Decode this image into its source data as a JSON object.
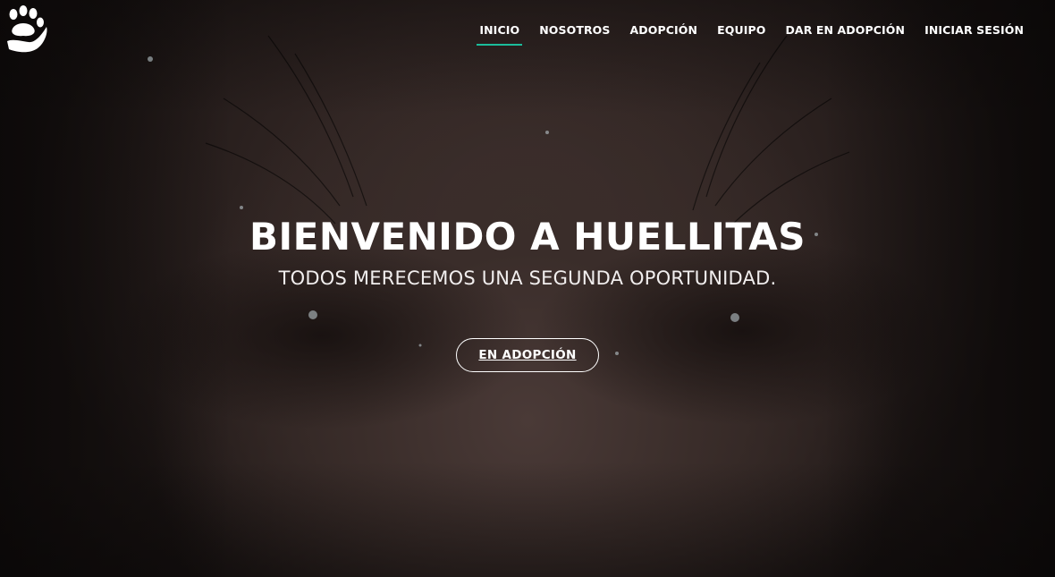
{
  "colors": {
    "accent": "#1bbc9b",
    "text": "#ffffff",
    "overlay": "#1a1413"
  },
  "brand": {
    "logo_icon": "paw-hand-icon"
  },
  "nav": {
    "items": [
      {
        "label": "INICIO",
        "active": true
      },
      {
        "label": "NOSOTROS",
        "active": false
      },
      {
        "label": "ADOPCIÓN",
        "active": false
      },
      {
        "label": "EQUIPO",
        "active": false
      },
      {
        "label": "DAR EN ADOPCIÓN",
        "active": false
      },
      {
        "label": "INICIAR SESIÓN",
        "active": false
      }
    ]
  },
  "hero": {
    "title": "BIENVENIDO A HUELLITAS",
    "subtitle": "TODOS MERECEMOS UNA SEGUNDA OPORTUNIDAD.",
    "cta_label": "EN ADOPCIÓN",
    "background": "dog-face-photo"
  }
}
